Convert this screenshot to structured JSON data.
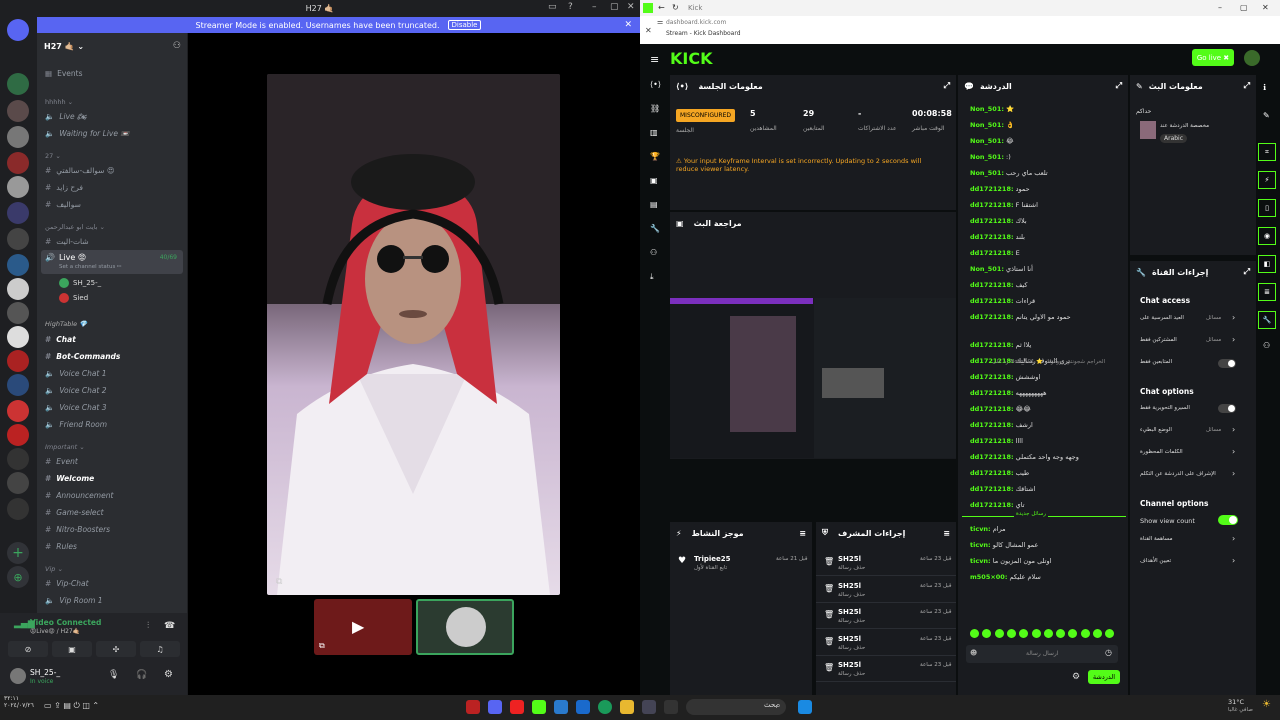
{
  "discord": {
    "top_title": "H27 🤙🏼",
    "banner_text": "Streamer Mode is enabled. Usernames have been truncated.",
    "banner_button": "Disable",
    "server_name": "H27 🤙🏼 ⌄",
    "events": "Events",
    "sections": [
      {
        "label": "hhhhh ⌄"
      },
      {
        "label": "Live 🏍"
      },
      {
        "label": "Waiting for Live 📼"
      },
      {
        "label": "27 ⌄"
      },
      {
        "label": "سوالف-سالفتي 😍"
      },
      {
        "label": "فرح زايد"
      },
      {
        "label": "سواليف"
      },
      {
        "label": "بايت ابو عبدالرحمن ⌄"
      },
      {
        "label": "شات-اليت"
      }
    ],
    "live_channel": "Live 😡",
    "live_count": "40/69",
    "channel_status": "Set a channel status ✏",
    "voice_users": [
      "SH_25-_",
      "Sied"
    ],
    "high_table": "HighTable 💎",
    "channels2": [
      "Chat",
      "Bot-Commands",
      "Voice Chat 1",
      "Voice Chat 2",
      "Voice Chat 3",
      "Friend Room"
    ],
    "important": "Important ⌄",
    "channels3": [
      "Event",
      "Welcome",
      "Announcement",
      "Game-select",
      "Nitro-Boosters",
      "Rules"
    ],
    "vip": "Vip ⌄",
    "channels4": [
      "Vip-Chat",
      "Vip Room 1"
    ],
    "video_connected": "Video Connected",
    "video_channel": "😡Live😡 / H27🤙🏼",
    "user_name": "SH_25-_",
    "user_status": "In voice"
  },
  "kick": {
    "tab_title": "Kick",
    "url": "dashboard.kick.com",
    "page_title": "Stream - Kick Dashboard",
    "go_live": "Go live ✖",
    "session": {
      "title": "معلومات الجلسة",
      "badge": "MISCONFIGURED",
      "badge_label": "الجلسة",
      "stats": [
        {
          "v": "5",
          "l": "المشاهدين"
        },
        {
          "v": "29",
          "l": "المتابعين"
        },
        {
          "v": "-",
          "l": "عدد الاشتراكات"
        },
        {
          "v": "00:08:58",
          "l": "الوقت مباشر"
        }
      ],
      "warning": "Your input Keyframe Interval is set incorrectly. Updating to 2 seconds will reduce viewer latency."
    },
    "review": {
      "title": "مراجعة البث"
    },
    "chat": {
      "title": "الدردشة",
      "messages": [
        {
          "u": "Non_501:",
          "t": "⭐"
        },
        {
          "u": "Non_501:",
          "t": "👌"
        },
        {
          "u": "Non_501:",
          "t": "😂"
        },
        {
          "u": "Non_501:",
          "t": ":)"
        },
        {
          "u": "Non_501:",
          "t": "تلعب ماي رحب"
        },
        {
          "u": "dd1721218:",
          "t": "حمود"
        },
        {
          "u": "dd1721218:",
          "t": "F اشتقنا"
        },
        {
          "u": "dd1721218:",
          "t": "بلاك"
        },
        {
          "u": "dd1721218:",
          "t": "بلند"
        },
        {
          "u": "dd1721218:",
          "t": "E"
        },
        {
          "u": "Non_501:",
          "t": "أنا استاذي"
        },
        {
          "u": "dd1721218:",
          "t": "كيف"
        },
        {
          "u": "dd1721218:",
          "t": "قراءات"
        },
        {
          "u": "dd1721218:",
          "t": "حمود مو الاولي يتانم"
        },
        {
          "u": "dd1721218:",
          "t": "يلاا ثم"
        },
        {
          "u": "dd1721218:",
          "t": "ترى الشوف رسالتك"
        },
        {
          "u": "dd1721218:",
          "t": "اوششش"
        },
        {
          "u": "dd1721218:",
          "t": "هههههههههه"
        },
        {
          "u": "dd1721218:",
          "t": "😂😂"
        },
        {
          "u": "dd1721218:",
          "t": "ارشف"
        },
        {
          "u": "dd1721218:",
          "t": "اااا"
        },
        {
          "u": "dd1721218:",
          "t": "وجهه وجه واحد مكتملي"
        },
        {
          "u": "dd1721218:",
          "t": "طيب"
        },
        {
          "u": "dd1721218:",
          "t": "اشتاقك"
        },
        {
          "u": "dd1721218:",
          "t": "تاي"
        }
      ],
      "reply_note": "رد على Non_501 ⭐ الخراجم شجونتي رووكونك",
      "new_messages": "رسائل جديدة",
      "new": [
        {
          "u": "ticvn:",
          "t": "مرام"
        },
        {
          "u": "ticvn:",
          "t": "عمو المشال كالو"
        },
        {
          "u": "ticvn:",
          "t": "اوتلى مون المزيون ما"
        },
        {
          "u": "m505×00:",
          "t": "سلام عليكم"
        }
      ],
      "input_placeholder": "ارسال رسالة",
      "send_button": "الدردشة"
    },
    "stream_info": {
      "title": "معلومات البث",
      "desc": "مخصصة الدردشة عند",
      "name": "حداكم",
      "lang": "Arabic"
    },
    "channel_actions": {
      "title": "إجراءات القناة",
      "chat_access": "Chat access",
      "items1": [
        {
          "l": "العيد السرسية على",
          "v": "مسائل"
        },
        {
          "l": "المشتركين فقط",
          "v": "مسائل"
        },
        {
          "l": "المتابعين فقط",
          "v": ""
        }
      ],
      "chat_options": "Chat options",
      "items2": [
        {
          "l": "السيرو التحويرية فقط",
          "v": ""
        },
        {
          "l": "الوضع البطيء",
          "v": "مسائل"
        },
        {
          "l": "الكلمات المحظورة",
          "v": ""
        },
        {
          "l": "الإشراف على الدردشة عن التكلم",
          "v": ""
        }
      ],
      "channel_options": "Channel options",
      "show_view": "Show view count",
      "items3": [
        {
          "l": "مساهمة القناة"
        },
        {
          "l": "تعيين الأهداف"
        }
      ]
    },
    "activity": {
      "title": "موجز النشاط",
      "user": "Tripiee25",
      "sub": "تابع القناة لأول",
      "time": "قبل 21 ساعة"
    },
    "mod": {
      "title": "إجراءات المشرف",
      "rows": [
        {
          "u": "SH25l",
          "s": "حذف رسالة",
          "t": "قبل 23 ساعة"
        },
        {
          "u": "SH25l",
          "s": "حذف رسالة",
          "t": "قبل 23 ساعة"
        },
        {
          "u": "SH25l",
          "s": "حذف رسالة",
          "t": "قبل 23 ساعة"
        },
        {
          "u": "SH25l",
          "s": "حذف رسالة",
          "t": "قبل 23 ساعة"
        },
        {
          "u": "SH25l",
          "s": "حذف رسالة",
          "t": "قبل 23 ساعة"
        }
      ]
    }
  },
  "taskbar": {
    "search": "بحث",
    "time": "٣٢:١١",
    "date": "٢٠٢٤/٠٧/٢٦",
    "weather": "31°C",
    "weather_sub": "صافي غالبا"
  }
}
